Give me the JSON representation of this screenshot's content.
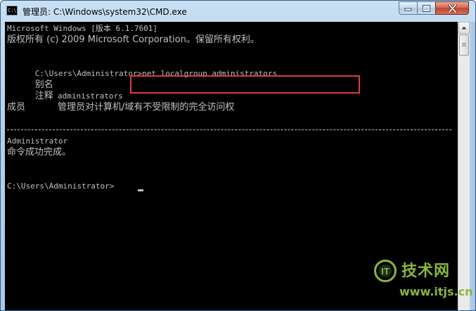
{
  "window": {
    "title": "管理员: C:\\Windows\\system32\\CMD.exe",
    "app_icon": "cmd-icon",
    "app_icon_label": "C:\\",
    "buttons": {
      "minimize": "minimize-icon",
      "maximize": "maximize-icon",
      "close": "close-icon"
    }
  },
  "console": {
    "background": "#000000",
    "foreground": "#c0c0c0",
    "lines": {
      "l1": "Microsoft Windows [版本 6.1.7601]",
      "l2": "版权所有 (c) 2009 Microsoft Corporation。保留所有权利。",
      "prompt1": "C:\\Users\\Administrator>",
      "command": "net localgroup administrators",
      "alias_label": "别名",
      "alias_value": "administrators",
      "comment_label": "注释",
      "comment_value": "管理员对计算机/域有不受限制的完全访问权",
      "members_label": "成员",
      "member": "Administrator",
      "result": "命令成功完成。",
      "prompt2": "C:\\Users\\Administrator>"
    },
    "highlight_color": "#e0393c"
  },
  "scrollbar": {
    "up_arrow": "scroll-up-arrow-icon"
  },
  "watermark": {
    "logo_text": "IT",
    "brand": "技术网",
    "url": "www.itjs.cn",
    "color": "#8ab63a"
  }
}
